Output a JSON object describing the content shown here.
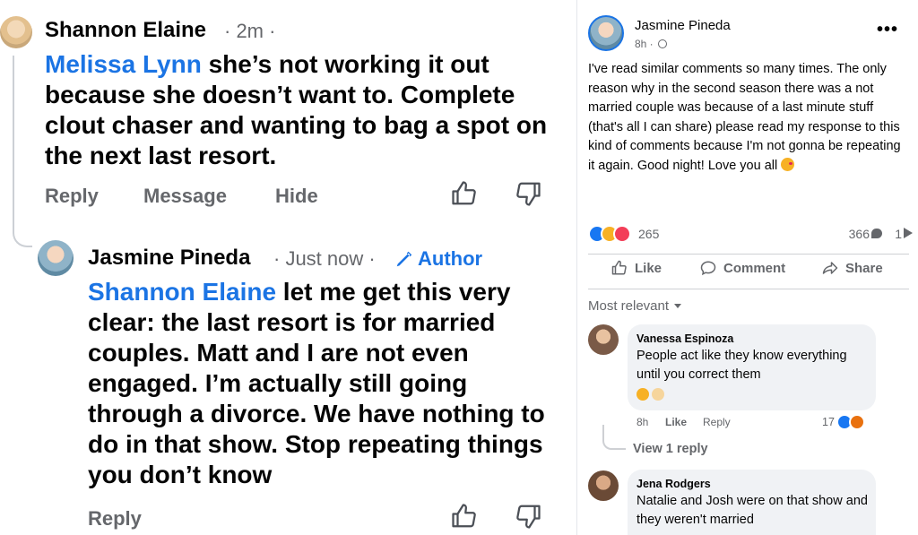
{
  "left": {
    "comment1": {
      "author": "Shannon Elaine",
      "time": "· 2m ·",
      "mention": "Melissa Lynn",
      "text": " she’s not working it out because she doesn’t want to. Complete clout chaser and wanting to bag a spot on the next last resort.",
      "actions": [
        "Reply",
        "Message",
        "Hide"
      ]
    },
    "comment2": {
      "author": "Jasmine Pineda",
      "time": "· Just now ·",
      "author_badge": "Author",
      "mention": "Shannon Elaine",
      "text": " let me get this very clear: the last resort is for married couples. Matt and I are not even engaged. I’m actually still going through a divorce. We have nothing to do in that show. Stop repeating things you don’t know",
      "reply_label": "Reply"
    }
  },
  "post": {
    "author": "Jasmine Pineda",
    "time": "8h ·",
    "more": "•••",
    "text": "I've read similar comments so many times. The only reason why in the second season there was a not married couple was because of a last minute stuff (that's all I can share) please read my response to this kind of comments because I'm not gonna be repeating it again. Good night! Love you all",
    "reactions_count": "265",
    "comments_count": "366",
    "shares_count": "1",
    "actions": {
      "like": "Like",
      "comment": "Comment",
      "share": "Share"
    },
    "sort_label": "Most relevant",
    "comments": [
      {
        "author": "Vanessa Espinoza",
        "text": "People act like they know everything until you correct them",
        "time": "8h",
        "like": "Like",
        "reply": "Reply",
        "reaction_count": "17",
        "view_replies": "View 1 reply"
      },
      {
        "author": "Jena Rodgers",
        "text": "Natalie and Josh were on that show and they weren't married"
      }
    ]
  },
  "colors": {
    "link_blue": "#1b74e4",
    "meta_gray": "#65676b",
    "bubble_bg": "#f0f2f5"
  }
}
